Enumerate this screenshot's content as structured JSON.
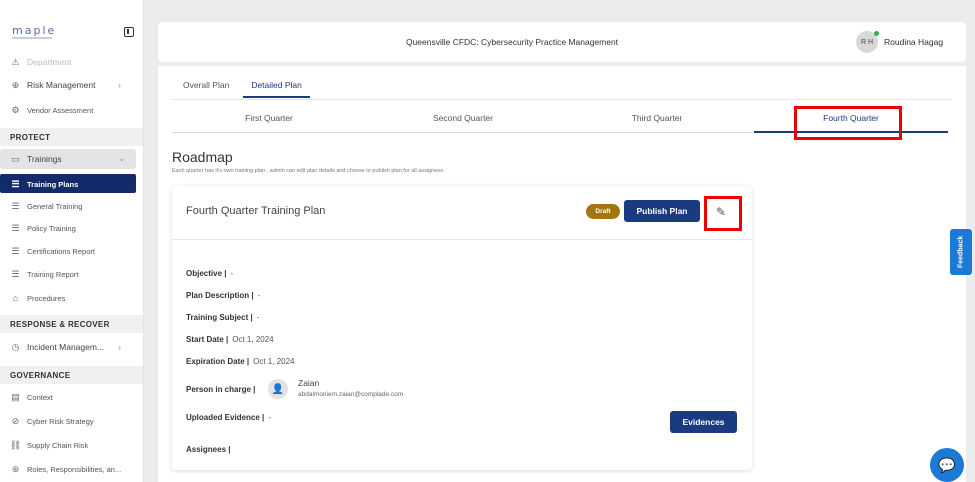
{
  "app": {
    "logo": "maple",
    "window_title": "Queensville CFDC: Cybersecurity Practice Management"
  },
  "user": {
    "initials": "R H",
    "name": "Roudina Hagag"
  },
  "sidebar": {
    "faded_item": "Department",
    "items_top": [
      {
        "label": "Risk Management",
        "icon": "risk-icon"
      },
      {
        "label": "Vendor Assessment",
        "icon": "vendor-icon"
      }
    ],
    "section_protect": "PROTECT",
    "trainings": "Trainings",
    "training_sub": [
      {
        "label": "Training Plans",
        "active": true
      },
      {
        "label": "General Training"
      },
      {
        "label": "Policy Training"
      },
      {
        "label": "Certifications Report"
      },
      {
        "label": "Training Report"
      }
    ],
    "procedures": "Procedures",
    "section_response": "RESPONSE & RECOVER",
    "incident": "Incident Managem...",
    "section_governance": "GOVERNANCE",
    "governance_items": [
      {
        "label": "Context"
      },
      {
        "label": "Cyber Risk Strategy"
      },
      {
        "label": "Supply Chain Risk"
      },
      {
        "label": "Roles, Responsibilities, an..."
      }
    ]
  },
  "tabs": [
    "Overall Plan",
    "Detailed Plan"
  ],
  "active_tab": "Detailed Plan",
  "quarters": [
    "First Quarter",
    "Second Quarter",
    "Third Quarter",
    "Fourth Quarter"
  ],
  "active_quarter": "Fourth Quarter",
  "roadmap": {
    "title": "Roadmap",
    "description": "Each quarter has it's own training plan , admin can edit plan details and choose to publish plan for all assignees."
  },
  "plan": {
    "title": "Fourth Quarter Training Plan",
    "status": "Draft",
    "publish_label": "Publish Plan",
    "fields": {
      "objective": {
        "label": "Objective |",
        "value": "-"
      },
      "description": {
        "label": "Plan Description |",
        "value": "-"
      },
      "subject": {
        "label": "Training Subject |",
        "value": "-"
      },
      "start": {
        "label": "Start Date |",
        "value": "Oct 1, 2024"
      },
      "expiration": {
        "label": "Expiration Date |",
        "value": "Oct 1, 2024"
      },
      "person": {
        "label": "Person in charge |",
        "name": "Zaian",
        "email": "abdalmoniem.zaian@complade.com"
      },
      "evidence": {
        "label": "Uploaded Evidence |",
        "value": "-"
      },
      "assignees": {
        "label": "Assignees |"
      }
    },
    "evidences_label": "Evidences"
  },
  "feedback": "Feedback",
  "colors": {
    "primary": "#1a3a82",
    "highlight": "#ee0000",
    "draft": "#a57512",
    "feedback": "#1c7ad6"
  }
}
